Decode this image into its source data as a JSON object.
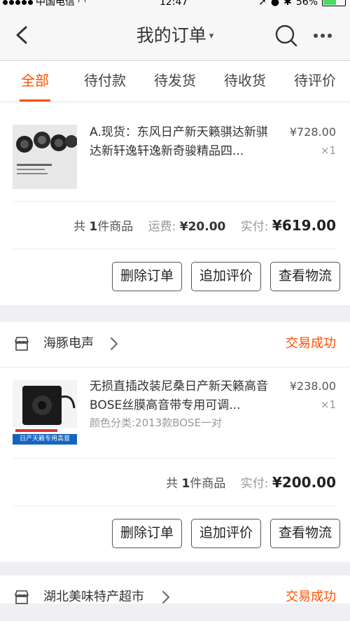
{
  "status_bar": {
    "carrier": "中国电信",
    "time": "12:47",
    "battery": "56%"
  },
  "nav": {
    "title": "我的订单",
    "title_caret": "▾"
  },
  "tabs": [
    {
      "label": "全部",
      "active": true
    },
    {
      "label": "待付款"
    },
    {
      "label": "待发货"
    },
    {
      "label": "待收货"
    },
    {
      "label": "待评价"
    }
  ],
  "orders": [
    {
      "item": {
        "title": "A.现货：东风日产新天籁骐达新骐达新轩逸轩逸新奇骏精品四...",
        "price": "¥728.00",
        "qty": "×1"
      },
      "summary": {
        "count_prefix": "共",
        "count": "1",
        "count_suffix": "件商品",
        "shipping_label": "运费:",
        "shipping": "¥20.00",
        "paid_label": "实付:",
        "paid": "¥619.00"
      },
      "buttons": {
        "delete": "删除订单",
        "review": "追加评价",
        "logistics": "查看物流"
      }
    },
    {
      "shop": {
        "name": "海豚电声",
        "status": "交易成功"
      },
      "item": {
        "title": "无损直插改装尼桑日产新天籁高音BOSE丝膜高音带专用可调...",
        "spec": "颜色分类:2013款BOSE一对",
        "price": "¥238.00",
        "qty": "×1",
        "thumb_caption": "日产天籁专用高音"
      },
      "summary": {
        "count_prefix": "共",
        "count": "1",
        "count_suffix": "件商品",
        "paid_label": "实付:",
        "paid": "¥200.00"
      },
      "buttons": {
        "delete": "删除订单",
        "review": "追加评价",
        "logistics": "查看物流"
      }
    },
    {
      "shop": {
        "name": "湖北美味特产超市",
        "status": "交易成功"
      }
    }
  ],
  "colors": {
    "accent": "#ff5000",
    "page_bg": "#efeff4"
  }
}
